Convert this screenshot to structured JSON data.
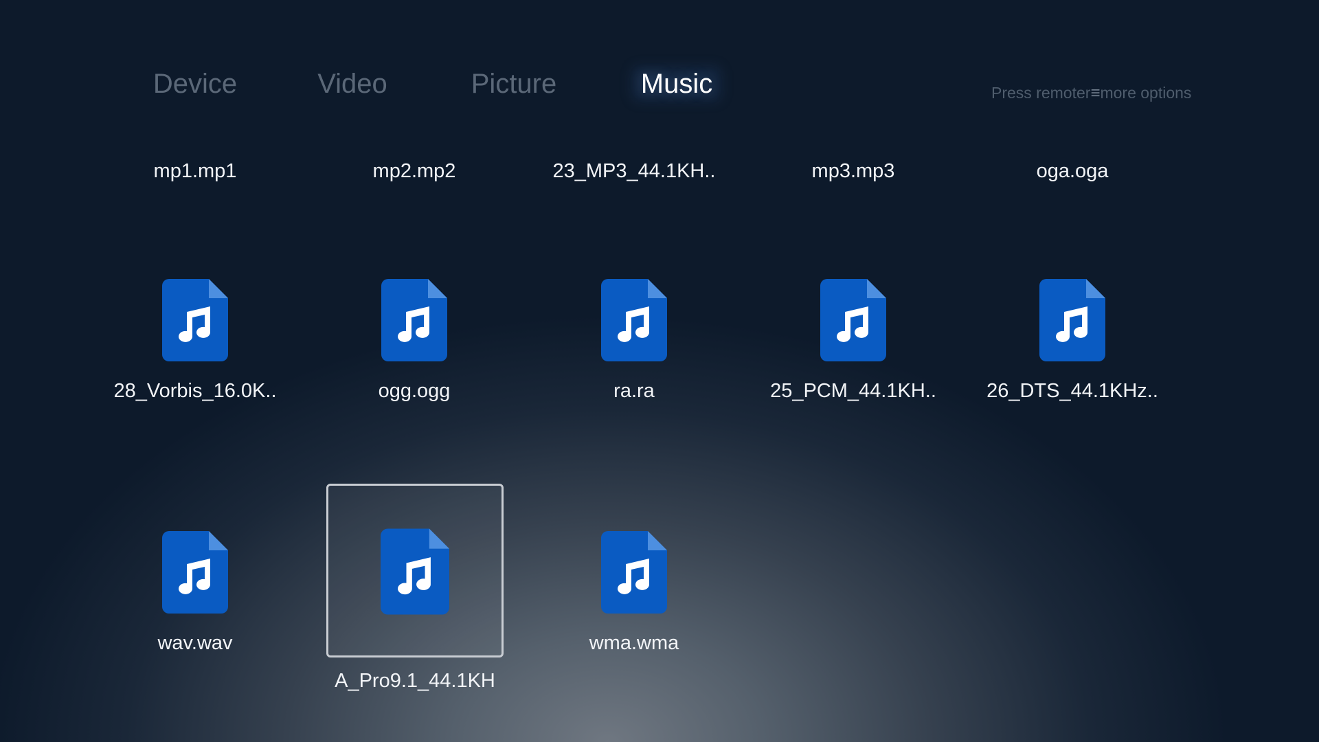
{
  "tabs": [
    {
      "label": "Device",
      "active": false
    },
    {
      "label": "Video",
      "active": false
    },
    {
      "label": "Picture",
      "active": false
    },
    {
      "label": "Music",
      "active": true
    }
  ],
  "hint": {
    "prefix": "Press remoter",
    "menu_icon": "menu-icon",
    "suffix": "more options"
  },
  "colors": {
    "file_icon_blue": "#0a5bc2",
    "file_icon_fold": "#4d8fe0",
    "tab_active": "#ffffff",
    "tab_inactive": "#5b6878",
    "focus_border": "#c9cdd3"
  },
  "files": {
    "row1_labels": [
      "mp1.mp1",
      "mp2.mp2",
      "23_MP3_44.1KH..",
      "mp3.mp3",
      "oga.oga"
    ],
    "row2": [
      {
        "label": "28_Vorbis_16.0K..",
        "icon": "music-file-icon"
      },
      {
        "label": "ogg.ogg",
        "icon": "music-file-icon"
      },
      {
        "label": "ra.ra",
        "icon": "music-file-icon"
      },
      {
        "label": "25_PCM_44.1KH..",
        "icon": "music-file-icon"
      },
      {
        "label": "26_DTS_44.1KHz..",
        "icon": "music-file-icon"
      }
    ],
    "row3": [
      {
        "label": "wav.wav",
        "icon": "music-file-icon",
        "focused": false
      },
      {
        "label": "A_Pro9.1_44.1KH",
        "icon": "music-file-icon",
        "focused": true
      },
      {
        "label": "wma.wma",
        "icon": "music-file-icon",
        "focused": false
      }
    ]
  }
}
